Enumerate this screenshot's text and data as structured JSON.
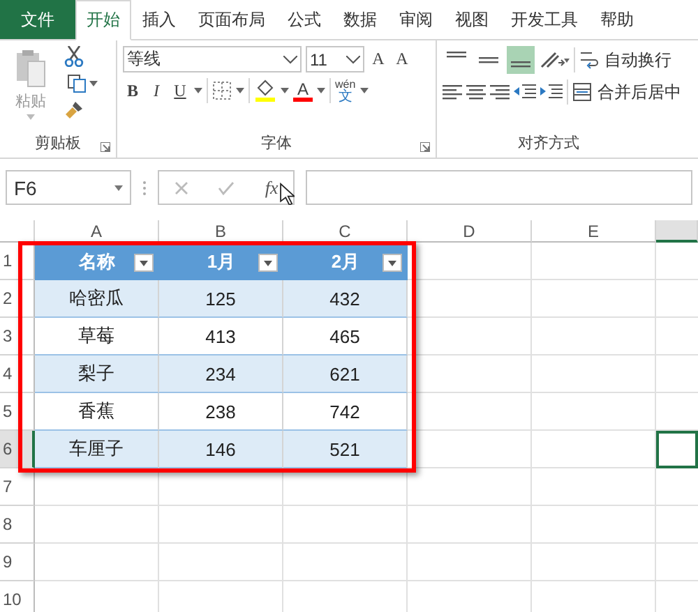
{
  "tabs": [
    {
      "label": "文件",
      "kind": "file",
      "selected": false
    },
    {
      "label": "开始",
      "kind": "tab",
      "selected": true
    },
    {
      "label": "插入",
      "kind": "tab",
      "selected": false
    },
    {
      "label": "页面布局",
      "kind": "tab",
      "selected": false
    },
    {
      "label": "公式",
      "kind": "tab",
      "selected": false
    },
    {
      "label": "数据",
      "kind": "tab",
      "selected": false
    },
    {
      "label": "审阅",
      "kind": "tab",
      "selected": false
    },
    {
      "label": "视图",
      "kind": "tab",
      "selected": false
    },
    {
      "label": "开发工具",
      "kind": "tab",
      "selected": false
    },
    {
      "label": "帮助",
      "kind": "tab",
      "selected": false
    }
  ],
  "ribbon": {
    "clipboard": {
      "label": "剪贴板",
      "paste_label": "粘贴"
    },
    "font": {
      "label": "字体",
      "font_name": "等线",
      "font_size": "11",
      "grow_label": "A",
      "shrink_label": "A",
      "styles": [
        "B",
        "I",
        "U"
      ],
      "font_color_label": "A",
      "phonetic_top": "wén",
      "phonetic_bottom": "文"
    },
    "alignment": {
      "label": "对齐方式",
      "vertical": [
        {
          "kind": "top",
          "selected": false
        },
        {
          "kind": "middle",
          "selected": false
        },
        {
          "kind": "bottom",
          "selected": true
        }
      ],
      "wrap_label": "自动换行",
      "merge_label": "合并后居中"
    }
  },
  "formula_bar": {
    "name_box": "F6",
    "function_label": "fx"
  },
  "grid": {
    "columns": [
      {
        "label": "A",
        "selected": false
      },
      {
        "label": "B",
        "selected": false
      },
      {
        "label": "C",
        "selected": false
      },
      {
        "label": "D",
        "selected": false
      },
      {
        "label": "E",
        "selected": false
      },
      {
        "selected": true
      }
    ],
    "rows": [
      {
        "label": "1",
        "selected": false
      },
      {
        "label": "2",
        "selected": false
      },
      {
        "label": "3",
        "selected": false
      },
      {
        "label": "4",
        "selected": false
      },
      {
        "label": "5",
        "selected": false
      },
      {
        "label": "6",
        "selected": true
      },
      {
        "label": "7",
        "selected": false
      },
      {
        "label": "8",
        "selected": false
      },
      {
        "label": "9",
        "selected": false
      },
      {
        "label": "10",
        "selected": false
      }
    ]
  },
  "table": {
    "columns": [
      "名称",
      "1月",
      "2月"
    ],
    "rows": [
      [
        "哈密瓜",
        "125",
        "432"
      ],
      [
        "草莓",
        "413",
        "465"
      ],
      [
        "梨子",
        "234",
        "621"
      ],
      [
        "香蕉",
        "238",
        "742"
      ],
      [
        "车厘子",
        "146",
        "521"
      ]
    ]
  }
}
